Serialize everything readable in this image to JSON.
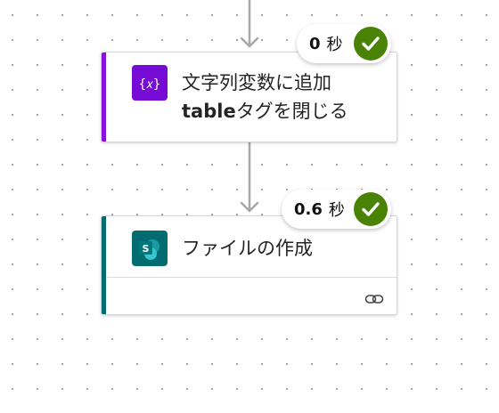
{
  "flow": {
    "steps": [
      {
        "title_line1": "文字列変数に追加",
        "title_line2_bold": "table",
        "title_line2_rest": "タグを閉じる",
        "icon": "variable-braces-icon",
        "accent_color": "#8711d9",
        "icon_bg_color": "#770bd6",
        "duration": "0",
        "duration_unit": "秒",
        "status": "success"
      },
      {
        "title": "ファイルの作成",
        "icon": "sharepoint-icon",
        "accent_color": "#036c70",
        "icon_bg_color": "#036c70",
        "duration": "0.6",
        "duration_unit": "秒",
        "status": "success",
        "footer_icon": "link-icon"
      }
    ],
    "success_color": "#498205",
    "connector_color": "#a8a8a8"
  }
}
